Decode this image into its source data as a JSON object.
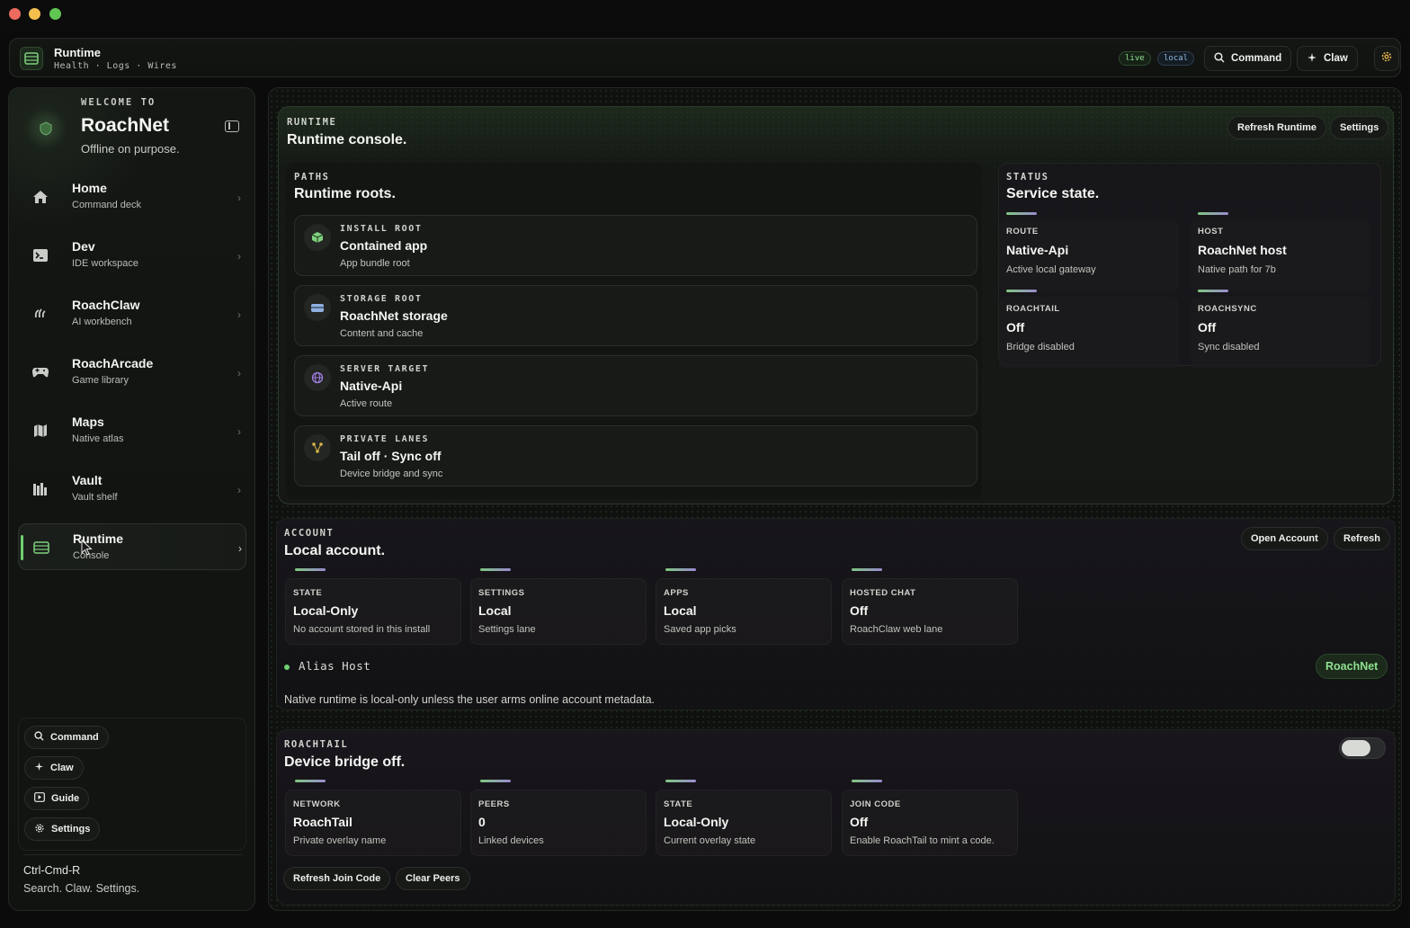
{
  "window": {
    "traffic_colors": [
      "#ed6a5e",
      "#f5bf4f",
      "#61c554"
    ]
  },
  "topbar": {
    "title": "Runtime",
    "subtitle": "Health · Logs · Wires",
    "tags": [
      {
        "label": "live",
        "color": "#8fe08f"
      },
      {
        "label": "local",
        "color": "#8fb8e0"
      }
    ],
    "command_label": "Command",
    "claw_label": "Claw",
    "settings_icon": "gear-icon"
  },
  "sidebar": {
    "welcome": "WELCOME TO",
    "brand": "RoachNet",
    "tagline": "Offline on purpose.",
    "items": [
      {
        "label": "Home",
        "sub": "Command deck",
        "icon": "home-icon"
      },
      {
        "label": "Dev",
        "sub": "IDE workspace",
        "icon": "terminal-icon"
      },
      {
        "label": "RoachClaw",
        "sub": "AI workbench",
        "icon": "claw-icon"
      },
      {
        "label": "RoachArcade",
        "sub": "Game library",
        "icon": "gamepad-icon"
      },
      {
        "label": "Maps",
        "sub": "Native atlas",
        "icon": "map-icon"
      },
      {
        "label": "Vault",
        "sub": "Vault shelf",
        "icon": "books-icon"
      },
      {
        "label": "Runtime",
        "sub": "Console",
        "icon": "server-icon",
        "active": true
      }
    ],
    "quick": {
      "command": "Command",
      "claw": "Claw",
      "guide": "Guide",
      "settings": "Settings"
    },
    "hotkey": "Ctrl-Cmd-R",
    "hotkey_sub": "Search. Claw. Settings."
  },
  "runtime": {
    "eyebrow": "RUNTIME",
    "title": "Runtime console.",
    "refresh_label": "Refresh Runtime",
    "settings_label": "Settings",
    "paths": {
      "eyebrow": "PATHS",
      "title": "Runtime roots.",
      "rows": [
        {
          "eyebrow": "INSTALL ROOT",
          "value": "Contained app",
          "desc": "App bundle root",
          "icon": "cube-icon"
        },
        {
          "eyebrow": "STORAGE ROOT",
          "value": "RoachNet storage",
          "desc": "Content and cache",
          "icon": "drive-icon"
        },
        {
          "eyebrow": "SERVER TARGET",
          "value": "Native-Api",
          "desc": "Active route",
          "icon": "globe-icon"
        },
        {
          "eyebrow": "PRIVATE LANES",
          "value": "Tail off · Sync off",
          "desc": "Device bridge and sync",
          "icon": "nodes-icon"
        }
      ]
    },
    "status": {
      "eyebrow": "STATUS",
      "title": "Service state.",
      "cards": [
        {
          "eyebrow": "ROUTE",
          "value": "Native-Api",
          "desc": "Active local gateway"
        },
        {
          "eyebrow": "HOST",
          "value": "RoachNet host",
          "desc": "Native path for 7b"
        },
        {
          "eyebrow": "ROACHTAIL",
          "value": "Off",
          "desc": "Bridge disabled"
        },
        {
          "eyebrow": "ROACHSYNC",
          "value": "Off",
          "desc": "Sync disabled"
        }
      ]
    }
  },
  "account": {
    "eyebrow": "ACCOUNT",
    "title": "Local account.",
    "open_label": "Open Account",
    "refresh_label": "Refresh",
    "cards": [
      {
        "eyebrow": "STATE",
        "value": "Local-Only",
        "desc": "No account stored in this install"
      },
      {
        "eyebrow": "SETTINGS",
        "value": "Local",
        "desc": "Settings lane"
      },
      {
        "eyebrow": "APPS",
        "value": "Local",
        "desc": "Saved app picks"
      },
      {
        "eyebrow": "HOSTED CHAT",
        "value": "Off",
        "desc": "RoachClaw web lane"
      }
    ],
    "alias_label": "Alias Host",
    "alias_value": "RoachNet",
    "note": "Native runtime is local-only unless the user arms online account metadata."
  },
  "roachtail": {
    "eyebrow": "ROACHTAIL",
    "title": "Device bridge off.",
    "toggle_on": false,
    "cards": [
      {
        "eyebrow": "NETWORK",
        "value": "RoachTail",
        "desc": "Private overlay name"
      },
      {
        "eyebrow": "PEERS",
        "value": "0",
        "desc": "Linked devices"
      },
      {
        "eyebrow": "STATE",
        "value": "Local-Only",
        "desc": "Current overlay state"
      },
      {
        "eyebrow": "JOIN CODE",
        "value": "Off",
        "desc": "Enable RoachTail to mint a code."
      }
    ],
    "refresh_join_label": "Refresh Join Code",
    "clear_peers_label": "Clear Peers"
  }
}
